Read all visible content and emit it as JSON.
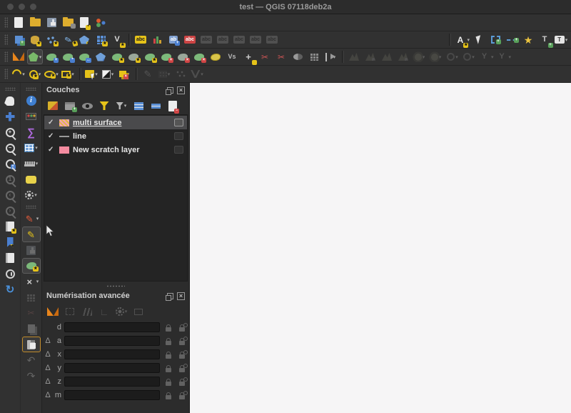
{
  "window": {
    "title": "test — QGIS 07118deb2a"
  },
  "colors": {
    "toolbar": "#313131",
    "panel": "#2c2c2c",
    "canvas": "#f6f5f6",
    "selection": "#4a4a4c",
    "accent_yellow": "#e6c319",
    "accent_blue": "#4a7fd0",
    "accent_green": "#7cb97a"
  },
  "layers_panel": {
    "title": "Couches",
    "layers": [
      {
        "label": "multi surface",
        "checked": "✓",
        "swatch": "sw-hatch",
        "selected": true,
        "indicator": "bright"
      },
      {
        "label": "line",
        "checked": "✓",
        "swatch": "sw-line",
        "selected": false,
        "indicator": ""
      },
      {
        "label": "New scratch layer",
        "checked": "✓",
        "swatch": "sw-pink",
        "selected": false,
        "indicator": ""
      }
    ]
  },
  "advanced_panel": {
    "title": "Numérisation avancée",
    "fields": [
      {
        "delta": "",
        "label": "d"
      },
      {
        "delta": "Δ",
        "label": "a"
      },
      {
        "delta": "Δ",
        "label": "x"
      },
      {
        "delta": "Δ",
        "label": "y"
      },
      {
        "delta": "Δ",
        "label": "z"
      },
      {
        "delta": "Δ",
        "label": "m"
      }
    ]
  },
  "toolbars": {
    "r1": [
      {
        "t": "h"
      },
      {
        "n": "new-project",
        "c": "i-page"
      },
      {
        "n": "open-project",
        "c": "i-folder"
      },
      {
        "n": "save-project",
        "c": "i-floppy"
      },
      {
        "n": "save-project-as",
        "c": "i-folder",
        "b": "bd-gr"
      },
      {
        "n": "project-properties",
        "c": "i-page",
        "b": "bd-y",
        "bg": "*"
      },
      {
        "n": "style-manager",
        "c": "i-style"
      }
    ],
    "r2": [
      {
        "t": "h"
      },
      {
        "n": "new-geopackage-layer",
        "c": "i-stackb",
        "b": "bd-g",
        "bg": "+"
      },
      {
        "n": "new-spatialite-layer",
        "c": "i-db",
        "b": "bd-y",
        "bg": "★"
      },
      {
        "n": "new-point-cloud-layer",
        "c": "i-pts",
        "b": "bd-y",
        "bg": "★"
      },
      {
        "n": "new-shapefile-layer",
        "c": "i-feather",
        "g": "✎",
        "b": "bd-y",
        "bg": "★"
      },
      {
        "n": "new-scratch-layer",
        "c": "i-polyb",
        "b": "bd-y",
        "bg": "★"
      },
      {
        "n": "new-mesh-layer",
        "c": "i-gridb",
        "b": "bd-y",
        "bg": "★"
      },
      {
        "n": "new-virtual-layer",
        "c": "i-zip",
        "g": "V",
        "b": "bd-y",
        "bg": "★"
      },
      {
        "t": "s"
      },
      {
        "n": "layer-labeling",
        "c": "i-label",
        "g": "abc"
      },
      {
        "n": "layer-diagram",
        "c": "i-chart"
      },
      {
        "n": "move-label",
        "c": "i-label blue",
        "g": "ab",
        "b": "bd-b",
        "bg": "+"
      },
      {
        "n": "change-label",
        "c": "i-label red",
        "g": "abc"
      },
      {
        "n": "pin-labels",
        "c": "i-label gray",
        "g": "abc",
        "st": "d"
      },
      {
        "n": "highlight-pinned-labels",
        "c": "i-label gray",
        "g": "abc",
        "st": "d"
      },
      {
        "n": "move-label-diagram",
        "c": "i-label gray",
        "g": "abc",
        "st": "d"
      },
      {
        "n": "rotate-label",
        "c": "i-label gray",
        "g": "abc",
        "st": "d"
      },
      {
        "n": "change-label-properties",
        "c": "i-label gray",
        "g": "abc",
        "st": "d"
      },
      {
        "t": "f"
      },
      {
        "t": "s"
      },
      {
        "n": "main-annotation-layer",
        "c": "i-A",
        "g": "A",
        "b": "bd-y",
        "bg": "★",
        "dd": 1
      },
      {
        "n": "select-annotation",
        "c": "i-cursorw"
      },
      {
        "n": "polygon-annotation",
        "c": "i-polydash",
        "b": "bd-g",
        "bg": "+"
      },
      {
        "n": "line-annotation",
        "c": "i-linedash",
        "b": "bd-g",
        "bg": "+"
      },
      {
        "n": "marker-annotation",
        "c": "i-star",
        "g": "★"
      },
      {
        "n": "text-annotation",
        "c": "i-T",
        "g": "T",
        "b": "bd-g",
        "bg": "+"
      },
      {
        "n": "text-annotation-bubble",
        "c": "i-bubble",
        "g": "T",
        "dd": 1
      }
    ],
    "r3": [
      {
        "t": "h"
      },
      {
        "n": "advanced-digitizing-tools",
        "c": "i-cad"
      },
      {
        "n": "shape-digitizing",
        "c": "i-pentagon",
        "st": "a",
        "dd": 1
      },
      {
        "n": "move-feature",
        "c": "i-feat",
        "b": "bd-b",
        "bg": "+"
      },
      {
        "n": "copy-move-feature",
        "c": "i-feat",
        "b": "bd-b",
        "bg": "*"
      },
      {
        "n": "rotate-feature",
        "c": "i-feat",
        "b": "bd-b",
        "bg": "↔"
      },
      {
        "n": "scale-feature",
        "c": "i-polyb",
        "b": "bd-b",
        "bg": "+"
      },
      {
        "n": "simplify-feature",
        "c": "i-feat",
        "b": "bd-y",
        "bg": "★"
      },
      {
        "n": "add-ring",
        "c": "i-feat2",
        "b": "bd-y",
        "bg": "★"
      },
      {
        "n": "add-part",
        "c": "i-feat",
        "b": "bd-y",
        "bg": "★"
      },
      {
        "n": "fill-ring",
        "c": "i-feat",
        "b": "bd-r",
        "bg": "×"
      },
      {
        "n": "delete-ring",
        "c": "i-feat2",
        "b": "bd-r",
        "bg": "×"
      },
      {
        "n": "delete-part",
        "c": "i-feat",
        "b": "bd-r",
        "bg": "×"
      },
      {
        "n": "reshape-features",
        "c": "i-feat-y"
      },
      {
        "n": "offset-curve",
        "c": "i-vs",
        "g": "Vs"
      },
      {
        "n": "trim-extend",
        "c": "i-cross",
        "g": "+",
        "b": "bd-y"
      },
      {
        "n": "split-features",
        "c": "i-scissors",
        "g": "✂"
      },
      {
        "n": "split-parts",
        "c": "i-scissors",
        "g": "✂"
      },
      {
        "n": "merge-features",
        "c": "i-half"
      },
      {
        "n": "merge-feature-attributes",
        "c": "i-gridg"
      },
      {
        "n": "rotate-point-symbols",
        "c": "i-flag",
        "dd": 1
      },
      {
        "t": "s"
      },
      {
        "n": "digitize-mesh-elements",
        "c": "i-mtn",
        "st": "d"
      },
      {
        "n": "select-mesh-elements",
        "c": "i-mtn",
        "st": "d",
        "b": "bd-gr",
        "bg": "→"
      },
      {
        "n": "transform-mesh-vertices",
        "c": "i-mtn",
        "st": "d"
      },
      {
        "n": "move-mesh-elements",
        "c": "i-mtn",
        "st": "d",
        "b": "bd-gr",
        "bg": "→"
      },
      {
        "n": "force-by-selected-geometries",
        "c": "i-sun",
        "st": "d",
        "dd": 1
      },
      {
        "n": "smooth-mesh",
        "c": "i-sun",
        "st": "d",
        "dd": 1
      },
      {
        "n": "reindex-mesh",
        "c": "i-circg",
        "st": "d",
        "dd": 1
      },
      {
        "n": "refine-mesh",
        "c": "i-circg",
        "st": "d",
        "dd": 1
      },
      {
        "n": "split-mesh-faces",
        "c": "i-Y",
        "g": "Y",
        "st": "d",
        "dd": 1
      },
      {
        "n": "merge-mesh-faces",
        "c": "i-Y",
        "g": "Y",
        "st": "d",
        "dd": 1
      }
    ],
    "r4": [
      {
        "t": "h"
      },
      {
        "n": "draw-circular-string",
        "c": "i-arc",
        "dd": 1
      },
      {
        "n": "draw-circle",
        "c": "i-ring",
        "b": "bd-y",
        "bg": "★",
        "dd": 1
      },
      {
        "n": "draw-ellipse",
        "c": "i-ellipse",
        "b": "bd-y",
        "bg": "★",
        "dd": 1
      },
      {
        "n": "draw-rectangle",
        "c": "i-rect",
        "b": "bd-y",
        "bg": "★",
        "dd": 1
      },
      {
        "t": "s"
      },
      {
        "n": "select-features",
        "c": "i-sely",
        "dd": 1
      },
      {
        "n": "select-by-form",
        "c": "i-diagbw",
        "dd": 1
      },
      {
        "n": "deselect-features",
        "c": "i-copyy",
        "b": "bd-r",
        "bg": "×",
        "dd": 1
      },
      {
        "t": "s"
      },
      {
        "n": "curve-digitizing",
        "c": "i-pencil gray",
        "g": "✎",
        "st": "d"
      },
      {
        "n": "select-by-raster",
        "c": "i-raster",
        "st": "d",
        "dd": 1
      },
      {
        "n": "regular-points",
        "c": "i-dotsg",
        "st": "d"
      },
      {
        "n": "digitize-spline",
        "c": "i-vgray",
        "st": "d",
        "dd": 1
      }
    ],
    "nav": [
      {
        "t": "h"
      },
      {
        "n": "pan-map",
        "c": "i-hand"
      },
      {
        "n": "pan-to-selection",
        "c": "i-pansel",
        "b": "bd-y",
        "bg": "★"
      },
      {
        "n": "zoom-in",
        "c": "i-mag",
        "g": "+"
      },
      {
        "n": "zoom-out",
        "c": "i-mag",
        "g": "−"
      },
      {
        "n": "zoom-to-selection",
        "c": "i-mag",
        "b": "bd-b",
        "bg": "+"
      },
      {
        "n": "zoom-to-native-resolution",
        "c": "i-mag",
        "g": "1",
        "st": "d"
      },
      {
        "n": "zoom-last",
        "c": "i-mag",
        "g": "‹",
        "st": "d"
      },
      {
        "n": "zoom-next",
        "c": "i-mag",
        "g": "›",
        "st": "d"
      },
      {
        "n": "new-spatial-bookmark",
        "c": "i-book",
        "b": "bd-y",
        "bg": "★"
      },
      {
        "n": "show-spatial-bookmarks",
        "c": "i-ribbon",
        "b": "bd-y",
        "bg": "★"
      },
      {
        "n": "bookmark-manager",
        "c": "i-book"
      },
      {
        "n": "temporal-controller",
        "c": "i-clock"
      },
      {
        "n": "refresh-map",
        "c": "i-refresh",
        "g": "↻"
      }
    ],
    "dig": [
      {
        "t": "h"
      },
      {
        "n": "identify-features",
        "c": "i-ident",
        "g": "i"
      },
      {
        "n": "run-feature-action",
        "c": "i-kbd"
      },
      {
        "n": "statistical-summary",
        "c": "i-sigma",
        "g": "∑"
      },
      {
        "n": "open-attribute-table",
        "c": "i-table",
        "dd": 1
      },
      {
        "n": "measure-line",
        "c": "i-ruler",
        "dd": 1
      },
      {
        "n": "map-tips",
        "c": "i-bubble-y"
      },
      {
        "n": "layer-actions",
        "c": "i-gear",
        "dd": 1
      },
      {
        "t": "h"
      },
      {
        "n": "current-edits",
        "c": "i-pencil red",
        "g": "✎",
        "dd": 1
      },
      {
        "n": "toggle-editing",
        "c": "i-pencil yel",
        "g": "✎",
        "st": "a"
      },
      {
        "n": "save-layer-edits",
        "c": "i-floppy",
        "st": "d"
      },
      {
        "n": "add-polygon-feature",
        "c": "i-feat",
        "b": "bd-y",
        "bg": "★",
        "st": "a"
      },
      {
        "n": "vertex-tool",
        "c": "i-vertex",
        "g": "×",
        "dd": 1
      },
      {
        "n": "modify-attributes",
        "c": "i-gridg",
        "st": "d"
      },
      {
        "n": "cut-features",
        "c": "i-scissors",
        "g": "✂",
        "st": "d"
      },
      {
        "n": "copy-features",
        "c": "i-pages",
        "st": "d"
      },
      {
        "n": "paste-features",
        "c": "i-clip",
        "st": "hl"
      },
      {
        "n": "undo",
        "c": "i-undo",
        "g": "↶",
        "st": "d"
      },
      {
        "n": "redo",
        "c": "i-redo",
        "g": "↷",
        "st": "d"
      }
    ],
    "layersbar": [
      {
        "n": "open-layer-styling",
        "c": "i-brush"
      },
      {
        "n": "add-group",
        "c": "i-group",
        "b": "bd-g",
        "bg": "+"
      },
      {
        "n": "manage-map-themes",
        "c": "i-eye"
      },
      {
        "n": "filter-legend",
        "c": "i-funnel"
      },
      {
        "n": "filter-by-expression",
        "c": "i-funnel sm",
        "dd": 1
      },
      {
        "n": "expand-all",
        "c": "i-expand"
      },
      {
        "n": "collapse-all",
        "c": "i-collapse"
      },
      {
        "n": "remove-layer",
        "c": "i-page",
        "b": "bd-r",
        "bg": "−"
      }
    ],
    "advbar": [
      {
        "n": "enable-advanced-digitizing",
        "c": "i-cad"
      },
      {
        "n": "construction-mode",
        "c": "i-construct",
        "st": "d"
      },
      {
        "n": "parallel-constraint",
        "c": "i-par",
        "st": "d"
      },
      {
        "n": "perpendicular-constraint",
        "c": "i-perp",
        "g": "∟",
        "st": "d"
      },
      {
        "n": "digitizing-settings",
        "c": "i-gear",
        "st": "d",
        "dd": 1
      },
      {
        "n": "toggle-floater",
        "c": "i-float",
        "st": "d"
      }
    ]
  }
}
